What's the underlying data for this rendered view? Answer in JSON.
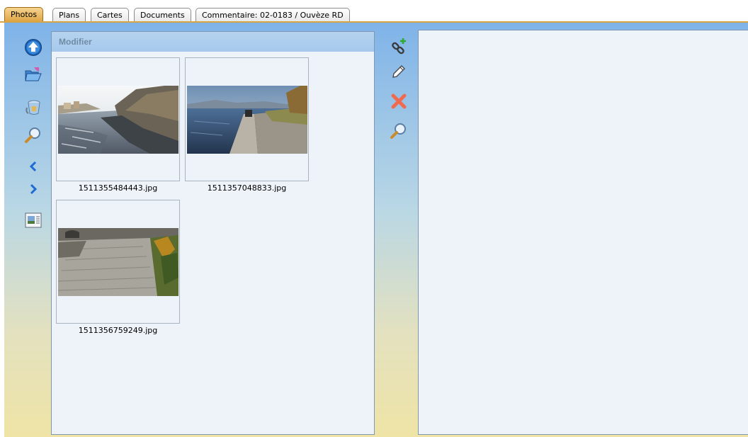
{
  "tabs": [
    {
      "label": "Photos",
      "active": true
    },
    {
      "label": "Plans",
      "active": false
    },
    {
      "label": "Cartes",
      "active": false
    },
    {
      "label": "Documents",
      "active": false
    },
    {
      "label": "Commentaire: 02-0183 / Ouvèze RD",
      "active": false
    }
  ],
  "left_toolbar": [
    {
      "icon": "upload-icon"
    },
    {
      "icon": "open-folder-icon"
    },
    {
      "icon": "bucket-icon"
    },
    {
      "icon": "magnifier-icon"
    },
    {
      "icon": "previous-icon"
    },
    {
      "icon": "next-icon"
    },
    {
      "icon": "slideshow-icon"
    }
  ],
  "gallery": {
    "header": "Modifier",
    "photos": [
      {
        "filename": "1511355484443.jpg"
      },
      {
        "filename": "1511357048833.jpg"
      },
      {
        "filename": "1511356759249.jpg"
      }
    ]
  },
  "middle_toolbar": [
    {
      "icon": "link-add-icon"
    },
    {
      "icon": "pencil-icon"
    },
    {
      "icon": "delete-icon"
    },
    {
      "icon": "magnifier-icon"
    }
  ],
  "colors": {
    "active_tab": "#dca13f",
    "panel_bg": "#eef3f9",
    "header_bg": "#a6c9ec",
    "delete_red": "#f06a4f"
  }
}
